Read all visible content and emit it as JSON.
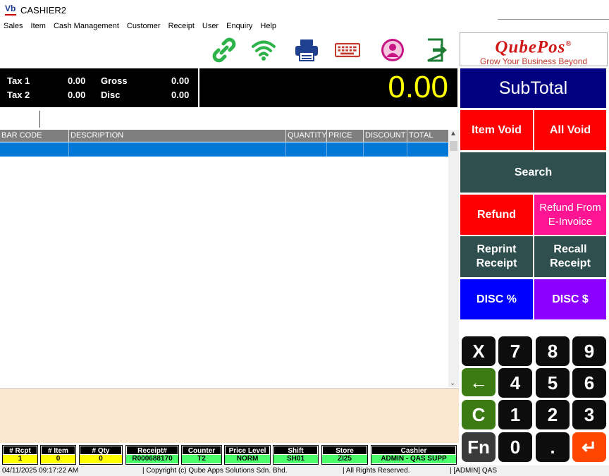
{
  "window": {
    "app_icon": "Vb",
    "title": "CASHIER2"
  },
  "menu": [
    "Sales",
    "Item",
    "Cash Management",
    "Customer",
    "Receipt",
    "User",
    "Enquiry",
    "Help"
  ],
  "toolbar": {
    "icons": [
      "link-icon",
      "wifi-icon",
      "printer-icon",
      "keyboard-icon",
      "user-icon",
      "exit-icon"
    ],
    "colors": {
      "link": "#2db34a",
      "wifi": "#2db34a",
      "printer": "#1f3f8f",
      "keyboard": "#c0392b",
      "user": "#c71585",
      "exit": "#1e7b34"
    }
  },
  "logo": {
    "title": "QubePos",
    "reg": "®",
    "tagline": "Grow Your Business Beyond"
  },
  "totals": {
    "tax1_label": "Tax 1",
    "tax1_value": "0.00",
    "tax2_label": "Tax 2",
    "tax2_value": "0.00",
    "gross_label": "Gross",
    "gross_value": "0.00",
    "disc_label": "Disc",
    "disc_value": "0.00",
    "grand_total": "0.00"
  },
  "grid": {
    "columns": [
      "BAR CODE",
      "DESCRIPTION",
      "QUANTITY",
      "PRICE",
      "DISCOUNT",
      "TOTAL"
    ],
    "rows": [
      [
        "",
        "",
        "",
        "",
        "",
        ""
      ]
    ]
  },
  "buttons": {
    "subtotal": "SubTotal",
    "item_void": "Item Void",
    "all_void": "All Void",
    "search": "Search",
    "refund": "Refund",
    "refund_einvoice": "Refund From E-Invoice",
    "reprint_receipt": "Reprint Receipt",
    "recall_receipt": "Recall Receipt",
    "disc_pct": "DISC %",
    "disc_amt": "DISC $"
  },
  "keypad": {
    "x": "X",
    "k7": "7",
    "k8": "8",
    "k9": "9",
    "back": "←",
    "k4": "4",
    "k5": "5",
    "k6": "6",
    "c": "C",
    "k1": "1",
    "k2": "2",
    "k3": "3",
    "fn": "Fn",
    "k0": "0",
    "dot": ".",
    "enter": "↵"
  },
  "status": [
    {
      "label": "# Rcpt",
      "value": "1"
    },
    {
      "label": "# Item",
      "value": "0"
    },
    {
      "label": "# Qty",
      "value": "0"
    },
    {
      "label": "Receipt#",
      "value": "R000688170"
    },
    {
      "label": "Counter",
      "value": "T2"
    },
    {
      "label": "Price Level",
      "value": "NORM"
    },
    {
      "label": "Shift",
      "value": "SH01"
    },
    {
      "label": "Store",
      "value": "ZI25"
    },
    {
      "label": "Cashier",
      "value": "ADMIN - QAS SUPP"
    }
  ],
  "footer": {
    "datetime": "04/11/2025  09:17:22 AM",
    "copyright": "| Copyright (c) Qube Apps Solutions Sdn. Bhd.",
    "rights": "| All Rights Reserved.",
    "user": "| [ADMIN] QAS"
  }
}
